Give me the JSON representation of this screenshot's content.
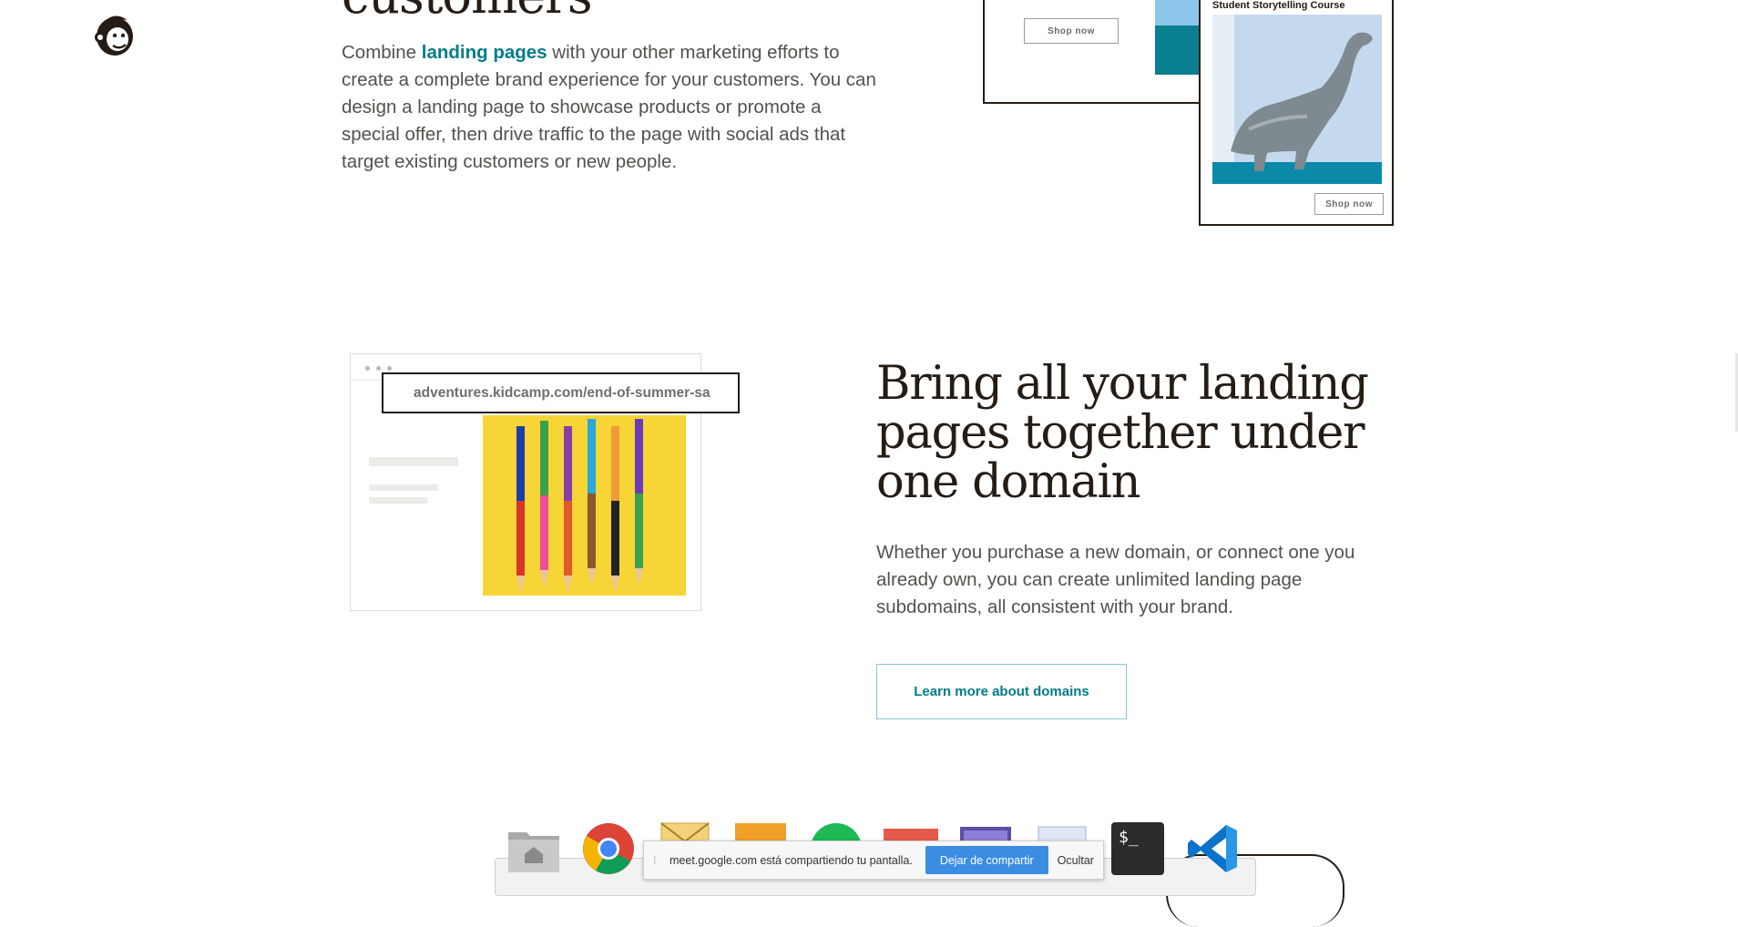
{
  "section1": {
    "heading": "customers",
    "para_before": "Combine ",
    "para_link": "landing pages",
    "para_after": " with your other marketing efforts to create a complete brand experience for your customers. You can design a landing page to showcase products or promote a special offer, then drive traffic to the page with social ads that target existing customers or new people.",
    "card1": {
      "shop_label": "Shop now"
    },
    "card2": {
      "title": "Student Storytelling Course",
      "shop_label": "Shop now"
    }
  },
  "section2": {
    "url": "adventures.kidcamp.com/end-of-summer-sa",
    "heading": "Bring all your landing pages together under one domain",
    "para": "Whether you purchase a new domain, or connect one you already own, you can create unlimited landing page subdomains, all consistent with your brand.",
    "cta_label": "Learn more about domains"
  },
  "sharebar": {
    "grip": "⁞",
    "message": "meet.google.com está compartiendo tu pantalla.",
    "stop_label": "Dejar de compartir",
    "hide_label": "Ocultar"
  },
  "dock": {
    "terminal_label": "$_"
  },
  "colors": {
    "link": "#007c89",
    "heading": "#241c15",
    "body_text": "#54514c",
    "pencil_bg": "#f7d536",
    "share_button": "#3b8de4"
  }
}
